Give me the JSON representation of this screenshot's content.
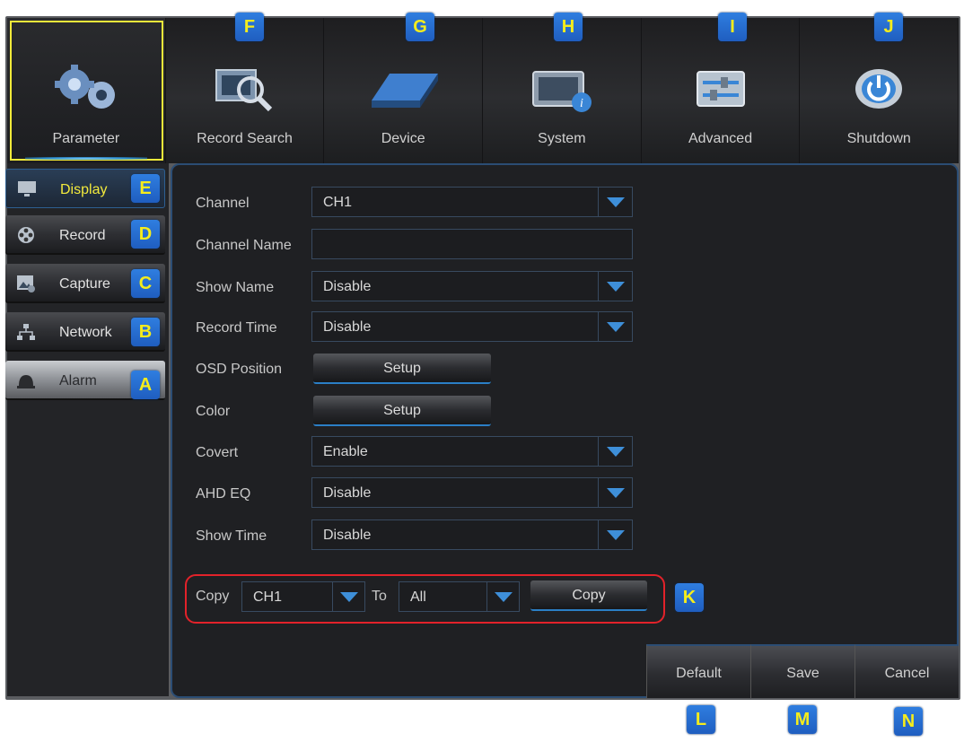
{
  "topnav": {
    "tabs": [
      {
        "label": "Parameter",
        "icon": "gears-icon"
      },
      {
        "label": "Record Search",
        "icon": "film-search-icon"
      },
      {
        "label": "Device",
        "icon": "hard-drive-icon"
      },
      {
        "label": "System",
        "icon": "system-info-icon"
      },
      {
        "label": "Advanced",
        "icon": "sliders-icon"
      },
      {
        "label": "Shutdown",
        "icon": "power-icon"
      }
    ]
  },
  "sidebar": {
    "items": [
      {
        "label": "Display",
        "icon": "monitor-icon"
      },
      {
        "label": "Record",
        "icon": "film-reel-icon"
      },
      {
        "label": "Capture",
        "icon": "picture-icon"
      },
      {
        "label": "Network",
        "icon": "network-icon"
      },
      {
        "label": "Alarm",
        "icon": "alarm-bell-icon"
      }
    ]
  },
  "form": {
    "channel": {
      "label": "Channel",
      "value": "CH1"
    },
    "channel_name": {
      "label": "Channel Name",
      "value": ""
    },
    "show_name": {
      "label": "Show Name",
      "value": "Disable"
    },
    "record_time": {
      "label": "Record Time",
      "value": "Disable"
    },
    "osd_position": {
      "label": "OSD Position",
      "button": "Setup"
    },
    "color": {
      "label": "Color",
      "button": "Setup"
    },
    "covert": {
      "label": "Covert",
      "value": "Enable"
    },
    "ahd_eq": {
      "label": "AHD EQ",
      "value": "Disable"
    },
    "show_time": {
      "label": "Show Time",
      "value": "Disable"
    }
  },
  "copy_row": {
    "label": "Copy",
    "from_value": "CH1",
    "to_label": "To",
    "to_value": "All",
    "button": "Copy"
  },
  "footer": {
    "default": "Default",
    "save": "Save",
    "cancel": "Cancel"
  },
  "callouts": {
    "a": "A",
    "b": "B",
    "c": "C",
    "d": "D",
    "e": "E",
    "f": "F",
    "g": "G",
    "h": "H",
    "i": "I",
    "j": "J",
    "k": "K",
    "l": "L",
    "m": "M",
    "n": "N"
  },
  "colors": {
    "accent_yellow": "#f3ea3c",
    "accent_blue": "#3e8fd9",
    "highlight_red": "#e2222a"
  }
}
